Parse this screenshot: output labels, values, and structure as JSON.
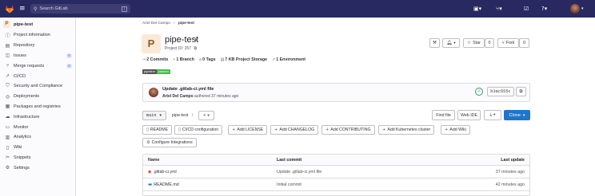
{
  "topbar": {
    "search_placeholder": "Search GitLab",
    "search_shortcut": "/",
    "icons": [
      "gitlab-logo-icon",
      "hamburger-menu-icon",
      "issues-icon",
      "merge-requests-icon",
      "todos-icon",
      "help-icon",
      "user-avatar"
    ]
  },
  "sidebar": {
    "project_initial": "P",
    "project_name": "pipe-test",
    "items": [
      {
        "label": "Project information",
        "icon": "info-icon"
      },
      {
        "label": "Repository",
        "icon": "repository-icon"
      },
      {
        "label": "Issues",
        "icon": "issues-icon",
        "badge": "0"
      },
      {
        "label": "Merge requests",
        "icon": "merge-request-icon",
        "badge": "0"
      },
      {
        "label": "CI/CD",
        "icon": "rocket-icon"
      },
      {
        "label": "Security and Compliance",
        "icon": "shield-icon"
      },
      {
        "label": "Deployments",
        "icon": "deployments-icon"
      },
      {
        "label": "Packages and registries",
        "icon": "package-icon"
      },
      {
        "label": "Infrastructure",
        "icon": "cloud-icon"
      },
      {
        "label": "Monitor",
        "icon": "monitor-icon"
      },
      {
        "label": "Analytics",
        "icon": "chart-icon"
      },
      {
        "label": "Wiki",
        "icon": "book-icon"
      },
      {
        "label": "Snippets",
        "icon": "snippet-icon"
      },
      {
        "label": "Settings",
        "icon": "gear-icon"
      }
    ]
  },
  "breadcrumb": {
    "owner": "Ariel Del Campo",
    "separator": "/",
    "project": "pipe-test"
  },
  "project": {
    "initial": "P",
    "name": "pipe-test",
    "id_label": "Project ID: 257",
    "star_label": "Star",
    "star_count": "0",
    "fork_label": "Fork",
    "fork_count": "0",
    "stats": {
      "commits": "2 Commits",
      "branches": "1 Branch",
      "tags": "0 Tags",
      "storage_value": "7 KB",
      "storage_label": "Project Storage",
      "environments": "1 Environment"
    },
    "pipeline_badge": {
      "left": "pipeline",
      "right": "passed"
    }
  },
  "last_commit": {
    "message": "Update .gitlab-ci.yml file",
    "author": "Ariel Del Campo",
    "action": "authored 37 minutes ago",
    "sha": "b3ac555c"
  },
  "repo_toolbar": {
    "branch": "main",
    "path": "pipe-test",
    "path_sep": "/",
    "add_label": "+",
    "find_file": "Find file",
    "web_ide": "Web IDE",
    "download_icon": "download-icon",
    "clone": "Clone"
  },
  "quick_actions": [
    {
      "label": "README",
      "icon": "file-icon"
    },
    {
      "label": "CI/CD configuration",
      "icon": "file-icon"
    },
    {
      "label": "Add LICENSE",
      "icon": "plus-icon"
    },
    {
      "label": "Add CHANGELOG",
      "icon": "plus-icon"
    },
    {
      "label": "Add CONTRIBUTING",
      "icon": "plus-icon"
    },
    {
      "label": "Add Kubernetes cluster",
      "icon": "plus-icon"
    },
    {
      "label": "Add Wiki",
      "icon": "plus-icon"
    },
    {
      "label": "Configure Integrations",
      "icon": "gear-icon"
    }
  ],
  "files_table": {
    "headers": [
      "Name",
      "Last commit",
      "Last update"
    ],
    "rows": [
      {
        "name": ".gitlab-ci.yml",
        "commit": "Update .gitlab-ci.yml file",
        "updated": "37 minutes ago",
        "icon": "gitlab-file-icon"
      },
      {
        "name": "README.md",
        "commit": "Initial commit",
        "updated": "42 minutes ago",
        "icon": "markdown-file-icon"
      }
    ]
  },
  "colors": {
    "topbar": "#292961",
    "primary": "#1f75cb",
    "pipeline_passed": "#44bb4a",
    "success": "#2da160"
  }
}
